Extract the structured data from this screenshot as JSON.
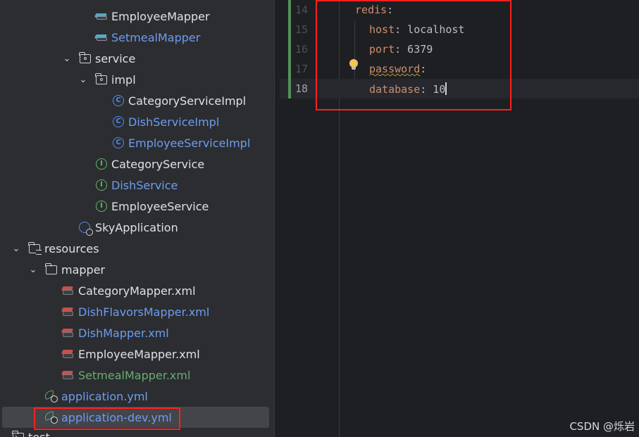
{
  "tree": {
    "items": [
      {
        "label": "EmployeeMapper",
        "icon": "mapper-interface-icon",
        "status": "default"
      },
      {
        "label": "SetmealMapper",
        "icon": "mapper-interface-icon",
        "status": "modified"
      },
      {
        "label": "service",
        "icon": "package-icon",
        "status": "default",
        "expanded": true
      },
      {
        "label": "impl",
        "icon": "package-icon",
        "status": "default",
        "expanded": true
      },
      {
        "label": "CategoryServiceImpl",
        "icon": "class-icon",
        "status": "default"
      },
      {
        "label": "DishServiceImpl",
        "icon": "class-icon",
        "status": "modified"
      },
      {
        "label": "EmployeeServiceImpl",
        "icon": "class-icon",
        "status": "modified"
      },
      {
        "label": "CategoryService",
        "icon": "interface-icon",
        "status": "default"
      },
      {
        "label": "DishService",
        "icon": "interface-icon",
        "status": "modified"
      },
      {
        "label": "EmployeeService",
        "icon": "interface-icon",
        "status": "default"
      },
      {
        "label": "SkyApplication",
        "icon": "spring-app-class-icon",
        "status": "default"
      },
      {
        "label": "resources",
        "icon": "resources-folder-icon",
        "status": "default",
        "expanded": true
      },
      {
        "label": "mapper",
        "icon": "folder-icon",
        "status": "default",
        "expanded": true
      },
      {
        "label": "CategoryMapper.xml",
        "icon": "mybatis-xml-icon",
        "status": "default"
      },
      {
        "label": "DishFlavorsMapper.xml",
        "icon": "mybatis-xml-icon",
        "status": "modified"
      },
      {
        "label": "DishMapper.xml",
        "icon": "mybatis-xml-icon",
        "status": "modified"
      },
      {
        "label": "EmployeeMapper.xml",
        "icon": "mybatis-xml-icon",
        "status": "default"
      },
      {
        "label": "SetmealMapper.xml",
        "icon": "mybatis-xml-icon",
        "status": "added"
      },
      {
        "label": "application.yml",
        "icon": "spring-yaml-icon",
        "status": "modified"
      },
      {
        "label": "application-dev.yml",
        "icon": "spring-yaml-icon",
        "status": "modified",
        "selected": true
      }
    ],
    "partial_bottom_label": "test"
  },
  "editor": {
    "lines": [
      {
        "number": "14",
        "key": "redis",
        "value": ""
      },
      {
        "number": "15",
        "key": "host",
        "value": " localhost"
      },
      {
        "number": "16",
        "key": "port",
        "value": " 6379"
      },
      {
        "number": "17",
        "key": "password",
        "value": ""
      },
      {
        "number": "18",
        "key": "database",
        "value": " 10"
      }
    ]
  },
  "colors": {
    "modified": "#6f9cf0",
    "added": "#6aab73",
    "highlight_box": "#ff2020",
    "yaml_key": "#cf8e6d"
  },
  "watermark": "CSDN @烁岩"
}
